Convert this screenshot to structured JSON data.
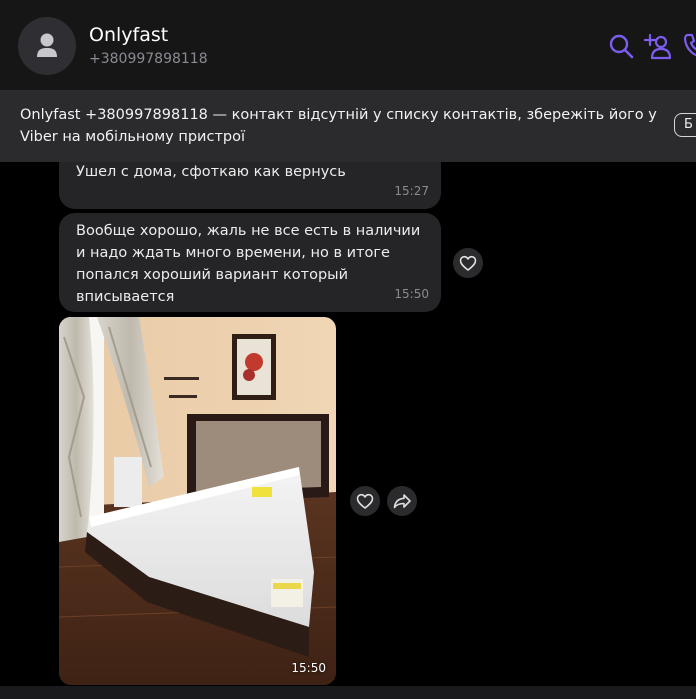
{
  "header": {
    "contact_name": "Onlyfast",
    "contact_phone": "+380997898118",
    "icons": [
      "search-icon",
      "add-contact-icon",
      "call-icon"
    ]
  },
  "banner": {
    "text": "Onlyfast +380997898118 — контакт відсутній у списку контактів, збережіть його у Viber на мобільному пристрої",
    "button_label": "Б"
  },
  "messages": [
    {
      "text": "Ушел с дома, сфоткаю как вернусь",
      "time": "15:27"
    },
    {
      "text": "Вообще хорошо, жаль не все есть в наличии и надо ждать много времени, но в итоге попался хороший вариант который вписывается",
      "time": "15:50"
    },
    {
      "type": "photo",
      "description": "",
      "time": "15:50"
    }
  ],
  "colors": {
    "accent": "#7d5cf0",
    "background": "#000000",
    "header_bg": "#161617",
    "banner_bg": "#2b2b2e",
    "bubble_bg": "#252528"
  }
}
